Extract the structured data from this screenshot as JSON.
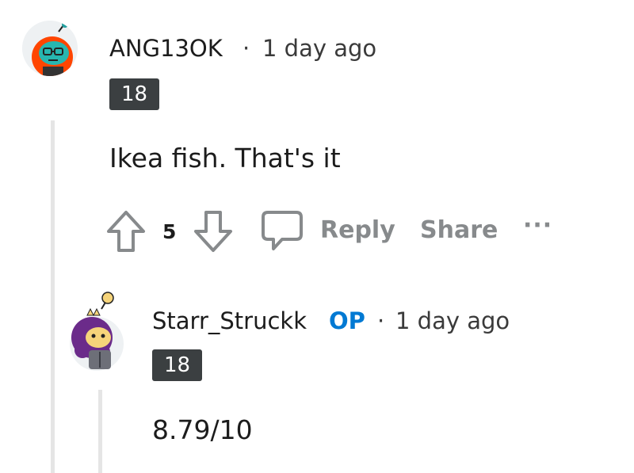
{
  "comments": [
    {
      "username": "ANG13OK",
      "separator": "·",
      "time": "1 day ago",
      "flair": "18",
      "body": "Ikea fish. That's it",
      "votes": "5",
      "actions": {
        "reply": "Reply",
        "share": "Share",
        "more": "···"
      },
      "avatar_icon": "snoo-avatar-icon"
    },
    {
      "username": "Starr_Struckk",
      "op_tag": "OP",
      "separator": "·",
      "time": "1 day ago",
      "flair": "18",
      "body": "8.79/10",
      "avatar_icon": "snoo-avatar-icon"
    }
  ],
  "colors": {
    "op": "#0079d3",
    "flair_bg": "#3b3f41",
    "action_gray": "#878a8c",
    "thread_line": "#e5e5e5"
  }
}
